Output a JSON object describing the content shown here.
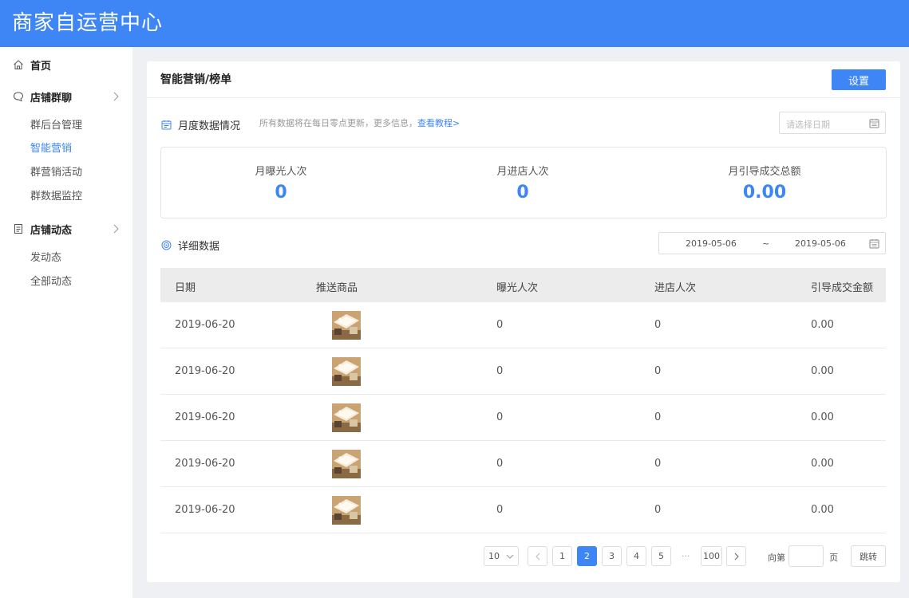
{
  "app": {
    "title": "商家自运营中心"
  },
  "sidebar": {
    "home": "首页",
    "group_chat": {
      "label": "店铺群聊",
      "items": [
        "群后台管理",
        "智能营销",
        "群营销活动",
        "群数据监控"
      ]
    },
    "dynamics": {
      "label": "店铺动态",
      "items": [
        "发动态",
        "全部动态"
      ]
    }
  },
  "page": {
    "title": "智能营销/榜单",
    "settings_button": "设置",
    "monthly": {
      "heading": "月度数据情况",
      "note": "所有数据将在每日零点更新，更多信息，",
      "note_link": "查看教程>",
      "date_placeholder": "请选择日期",
      "stats": [
        {
          "label": "月曝光人次",
          "value": "0"
        },
        {
          "label": "月进店人次",
          "value": "0"
        },
        {
          "label": "月引导成交总额",
          "value": "0.00"
        }
      ]
    },
    "detail": {
      "heading": "详细数据",
      "range_start": "2019-05-06",
      "range_sep": "~",
      "range_end": "2019-05-06",
      "columns": [
        "日期",
        "推送商品",
        "曝光人次",
        "进店人次",
        "引导成交金额"
      ],
      "rows": [
        {
          "date": "2019-06-20",
          "exposure": "0",
          "visits": "0",
          "amount": "0.00"
        },
        {
          "date": "2019-06-20",
          "exposure": "0",
          "visits": "0",
          "amount": "0.00"
        },
        {
          "date": "2019-06-20",
          "exposure": "0",
          "visits": "0",
          "amount": "0.00"
        },
        {
          "date": "2019-06-20",
          "exposure": "0",
          "visits": "0",
          "amount": "0.00"
        },
        {
          "date": "2019-06-20",
          "exposure": "0",
          "visits": "0",
          "amount": "0.00"
        }
      ]
    },
    "pagination": {
      "page_size": "10",
      "pages": [
        "1",
        "2",
        "3",
        "4",
        "5"
      ],
      "current": "2",
      "ellipsis": "···",
      "last": "100",
      "goto_prefix": "向第",
      "goto_suffix": "页",
      "goto_button": "跳转"
    }
  },
  "colors": {
    "brand": "#3e86f5"
  }
}
